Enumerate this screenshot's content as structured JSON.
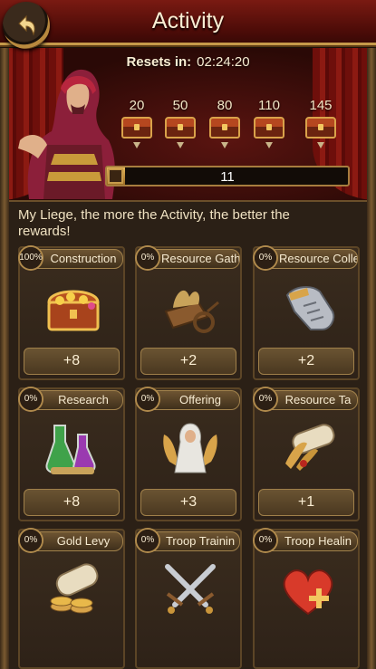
{
  "header": {
    "title": "Activity"
  },
  "banner": {
    "resets_label": "Resets in:",
    "resets_time": "02:24:20",
    "milestones": [
      {
        "value": "20"
      },
      {
        "value": "50"
      },
      {
        "value": "80"
      },
      {
        "value": "110"
      },
      {
        "value": "145"
      }
    ],
    "progress": {
      "current": "11",
      "fraction": 0.076
    }
  },
  "message": "My Liege, the more the Activity, the better the rewards!",
  "cards": [
    {
      "label": "Construction",
      "percent": "100%",
      "reward": "+8",
      "icon": "treasure-chest-icon"
    },
    {
      "label": "Resource Gathe",
      "percent": "0%",
      "reward": "+2",
      "icon": "resource-cart-icon"
    },
    {
      "label": "Resource Colle",
      "percent": "0%",
      "reward": "+2",
      "icon": "gauntlet-icon"
    },
    {
      "label": "Research",
      "percent": "0%",
      "reward": "+8",
      "icon": "potion-flasks-icon"
    },
    {
      "label": "Offering",
      "percent": "0%",
      "reward": "+3",
      "icon": "praying-angel-icon"
    },
    {
      "label": "Resource Ta",
      "percent": "0%",
      "reward": "+1",
      "icon": "scroll-wheat-icon"
    },
    {
      "label": "Gold Levy",
      "percent": "0%",
      "reward": "",
      "icon": "scroll-coins-icon"
    },
    {
      "label": "Troop Trainin",
      "percent": "0%",
      "reward": "",
      "icon": "crossed-swords-icon"
    },
    {
      "label": "Troop Healin",
      "percent": "0%",
      "reward": "",
      "icon": "heart-heal-icon"
    }
  ],
  "colors": {
    "header_red": "#7a1a12",
    "gold_trim": "#c69a4a",
    "panel": "#2b2016"
  }
}
